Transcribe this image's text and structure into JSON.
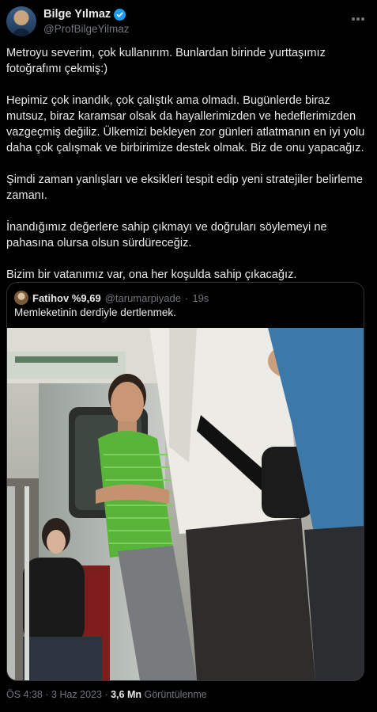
{
  "author": {
    "name": "Bilge Yılmaz",
    "handle": "@ProfBilgeYilmaz"
  },
  "tweet": {
    "paragraphs": [
      "Metroyu severim, çok kullanırım. Bunlardan birinde yurttaşımız fotoğrafımı çekmiş:)",
      "Hepimiz çok inandık, çok çalıştık ama olmadı. Bugünlerde biraz mutsuz, biraz karamsar olsak da hayallerimizden ve hedeflerimizden vazgeçmiş değiliz. Ülkemizi bekleyen zor günleri atlatmanın en iyi yolu daha çok çalışmak ve birbirimize destek olmak. Biz de onu yapacağız.",
      "Şimdi zaman yanlışları ve eksikleri tespit edip yeni stratejiler belirleme zamanı.",
      "İnandığımız değerlere sahip çıkmayı ve doğruları söylemeyi ne pahasına olursa olsun sürdüreceğiz.",
      "Bizim bir vatanımız var, ona her koşulda sahip çıkacağız."
    ]
  },
  "quoted": {
    "name": "Fatihov %9,69",
    "handle": "@tarumarpiyade",
    "separator": "·",
    "time": "19s",
    "text": "Memleketinin derdiyle dertlenmek."
  },
  "footer": {
    "time": "ÖS 4:38",
    "separator": "·",
    "date": "3 Haz 2023",
    "views_count": "3,6 Mn",
    "views_label": "Görüntülenme"
  },
  "colors": {
    "background": "#000000",
    "text": "#e7e9ea",
    "muted": "#71767b",
    "verified": "#1d9bf0",
    "border": "#2f3336"
  }
}
